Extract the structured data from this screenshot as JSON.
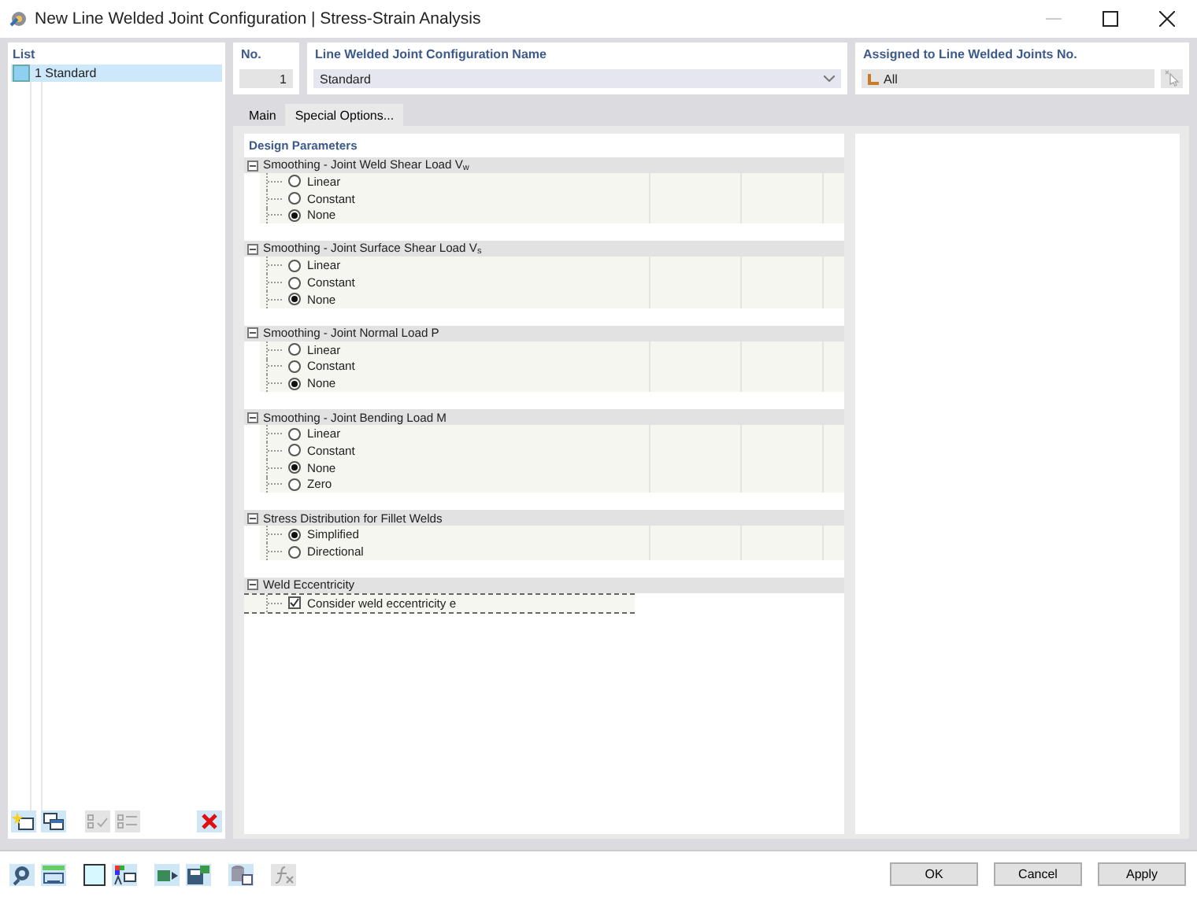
{
  "window": {
    "title": "New Line Welded Joint Configuration | Stress-Strain Analysis"
  },
  "list": {
    "title": "List",
    "items": [
      {
        "number": "1",
        "name": "Standard",
        "selected": true
      }
    ]
  },
  "number_field": {
    "label": "No.",
    "value": "1"
  },
  "name_field": {
    "label": "Line Welded Joint Configuration Name",
    "value": "Standard"
  },
  "assigned_field": {
    "label": "Assigned to Line Welded Joints No.",
    "value": "All"
  },
  "tabs": [
    {
      "label": "Main",
      "selected": false
    },
    {
      "label": "Special Options...",
      "selected": true
    }
  ],
  "tree": {
    "title": "Design Parameters",
    "groups": [
      {
        "title": "Smoothing - Joint Weld Shear Load V$_{w}$",
        "expanded": true,
        "options": [
          {
            "kind": "radio",
            "label": "Linear",
            "selected": false
          },
          {
            "kind": "radio",
            "label": "Constant",
            "selected": false
          },
          {
            "kind": "radio",
            "label": "None",
            "selected": true
          }
        ]
      },
      {
        "title": "Smoothing - Joint Surface Shear Load V$_{s}$",
        "expanded": true,
        "options": [
          {
            "kind": "radio",
            "label": "Linear",
            "selected": false
          },
          {
            "kind": "radio",
            "label": "Constant",
            "selected": false
          },
          {
            "kind": "radio",
            "label": "None",
            "selected": true
          }
        ]
      },
      {
        "title": "Smoothing - Joint Normal Load P",
        "expanded": true,
        "options": [
          {
            "kind": "radio",
            "label": "Linear",
            "selected": false
          },
          {
            "kind": "radio",
            "label": "Constant",
            "selected": false
          },
          {
            "kind": "radio",
            "label": "None",
            "selected": true
          }
        ]
      },
      {
        "title": "Smoothing - Joint Bending Load M",
        "expanded": true,
        "options": [
          {
            "kind": "radio",
            "label": "Linear",
            "selected": false
          },
          {
            "kind": "radio",
            "label": "Constant",
            "selected": false
          },
          {
            "kind": "radio",
            "label": "None",
            "selected": true
          },
          {
            "kind": "radio",
            "label": "Zero",
            "selected": false
          }
        ]
      },
      {
        "title": "Stress Distribution for Fillet Welds",
        "expanded": true,
        "options": [
          {
            "kind": "radio",
            "label": "Simplified",
            "selected": true
          },
          {
            "kind": "radio",
            "label": "Directional",
            "selected": false
          }
        ]
      },
      {
        "title": "Weld Eccentricity",
        "expanded": true,
        "options": [
          {
            "kind": "checkbox",
            "label": "Consider weld eccentricity e",
            "checked": true
          }
        ]
      }
    ]
  },
  "buttons": [
    {
      "label": "OK"
    },
    {
      "label": "Cancel"
    },
    {
      "label": "Apply"
    }
  ]
}
